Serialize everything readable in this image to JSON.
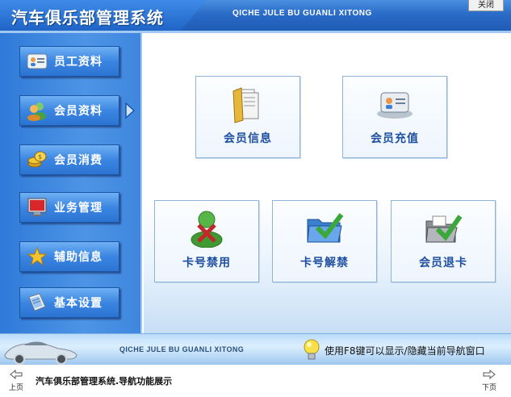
{
  "header": {
    "title": "汽车俱乐部管理系统",
    "title_pinyin": "QICHE JULE BU GUANLI XITONG",
    "close_label": "关闭"
  },
  "sidebar": {
    "items": [
      {
        "label": "员工资料",
        "icon": "staff-card-icon"
      },
      {
        "label": "会员资料",
        "icon": "members-icon"
      },
      {
        "label": "会员消费",
        "icon": "coins-icon"
      },
      {
        "label": "业务管理",
        "icon": "monitor-icon"
      },
      {
        "label": "辅助信息",
        "icon": "star-icon"
      },
      {
        "label": "基本设置",
        "icon": "settings-book-icon"
      }
    ],
    "selected": "会员资料"
  },
  "main": {
    "tiles": [
      {
        "label": "会员信息",
        "icon": "folder-documents-icon"
      },
      {
        "label": "会员充值",
        "icon": "member-card-icon"
      },
      {
        "label": "卡号禁用",
        "icon": "user-disabled-icon"
      },
      {
        "label": "卡号解禁",
        "icon": "folder-check-icon"
      },
      {
        "label": "会员退卡",
        "icon": "card-return-icon"
      }
    ]
  },
  "status": {
    "pinyin": "QICHE JULE BU GUANLI XITONG",
    "hint": "使用F8键可以显示/隐藏当前导航窗口"
  },
  "footer": {
    "prev_label": "上页",
    "next_label": "下页",
    "caption": "汽车俱乐部管理系统.导航功能展示"
  },
  "colors": {
    "accent": "#2f7ad8",
    "tile_text": "#1f4fa0",
    "tile_border": "#8fb3d9"
  }
}
